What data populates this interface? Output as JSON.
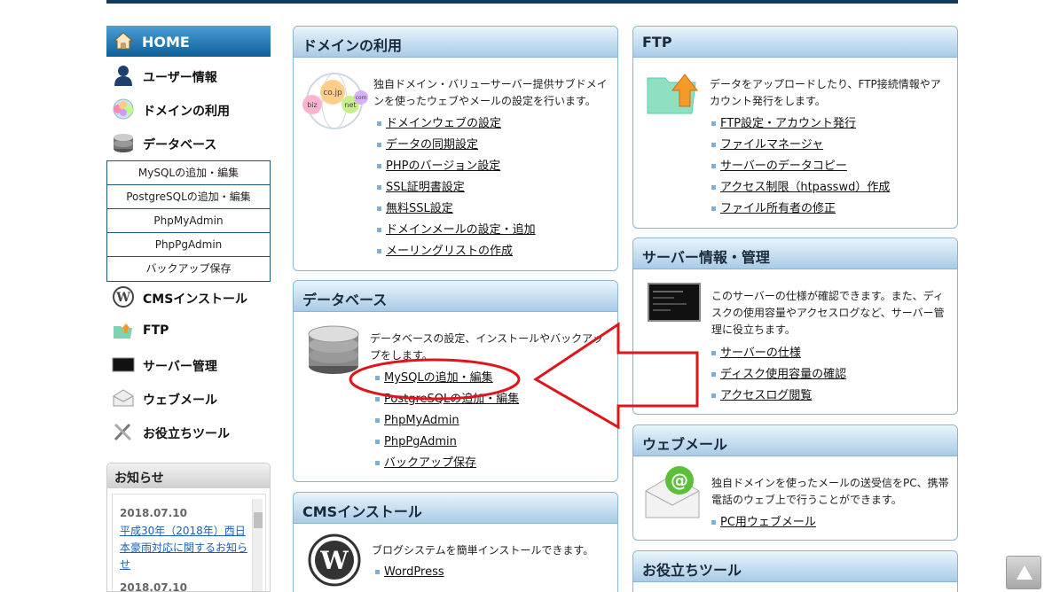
{
  "sidebar": {
    "home": "HOME",
    "items": [
      {
        "label": "ユーザー情報",
        "icon": "user-icon"
      },
      {
        "label": "ドメインの利用",
        "icon": "domain-globe-icon"
      },
      {
        "label": "データベース",
        "icon": "database-icon"
      }
    ],
    "db_sub": [
      "MySQLの追加・編集",
      "PostgreSQLの追加・編集",
      "PhpMyAdmin",
      "PhpPgAdmin",
      "バックアップ保存"
    ],
    "items2": [
      {
        "label": "CMSインストール",
        "icon": "wordpress-icon"
      },
      {
        "label": "FTP",
        "icon": "ftp-folder-icon"
      },
      {
        "label": "サーバー管理",
        "icon": "terminal-icon"
      },
      {
        "label": "ウェブメール",
        "icon": "mail-icon"
      },
      {
        "label": "お役立ちツール",
        "icon": "tools-icon"
      }
    ],
    "notice": {
      "title": "お知らせ",
      "date1": "2018.07.10",
      "text1": "平成30年（2018年）西日本豪雨対応に関するお知らせ",
      "date2": "2018.07.10"
    }
  },
  "panels": {
    "domain": {
      "title": "ドメインの利用",
      "desc": "独自ドメイン・バリューサーバー提供サブドメインを使ったウェブやメールの設定を行います。",
      "globe_labels": [
        "co.jp",
        "net",
        "com",
        "biz"
      ],
      "links": [
        "ドメインウェブの設定",
        "データの同期設定",
        "PHPのバージョン設定",
        "SSL証明書設定",
        "無料SSL設定",
        "ドメインメールの設定・追加",
        "メーリングリストの作成"
      ]
    },
    "database": {
      "title": "データベース",
      "desc": "データベースの設定、インストールやバックアップをします。",
      "links": [
        "MySQLの追加・編集",
        "PostgreSQLの追加・編集",
        "PhpMyAdmin",
        "PhpPgAdmin",
        "バックアップ保存"
      ]
    },
    "cms": {
      "title": "CMSインストール",
      "desc": "ブログシステムを簡単インストールできます。",
      "links": [
        "WordPress"
      ]
    },
    "ftp": {
      "title": "FTP",
      "desc": "データをアップロードしたり、FTP接続情報やアカウント発行をします。",
      "links": [
        "FTP設定・アカウント発行",
        "ファイルマネージャ",
        "サーバーのデータコピー",
        "アクセス制限（htpasswd）作成",
        "ファイル所有者の修正"
      ]
    },
    "server": {
      "title": "サーバー情報・管理",
      "desc": "このサーバーの仕様が確認できます。また、ディスクの使用容量やアクセスログなど、サーバー管理に役立ちます。",
      "links": [
        "サーバーの仕様",
        "ディスク使用容量の確認",
        "アクセスログ閲覧"
      ]
    },
    "webmail": {
      "title": "ウェブメール",
      "desc": "独自ドメインを使ったメールの送受信をPC、携帯電話のウェブ上で行うことができます。",
      "links": [
        "PC用ウェブメール"
      ]
    },
    "tools": {
      "title": "お役立ちツール"
    }
  },
  "annotation_color": "#e0151b"
}
